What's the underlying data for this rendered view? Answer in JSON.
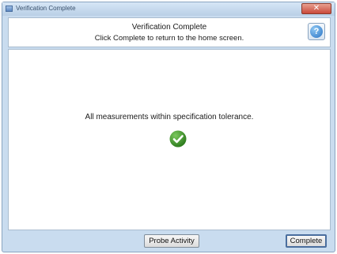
{
  "window": {
    "title": "Verification Complete",
    "close_glyph": "✕"
  },
  "header": {
    "title": "Verification Complete",
    "subtitle": "Click Complete to return to the home screen.",
    "help_icon": "question-mark-icon",
    "help_glyph": "?"
  },
  "main": {
    "message": "All measurements within specification tolerance.",
    "status_icon": "check-circle-icon",
    "status_color": "#3f9a2c"
  },
  "footer": {
    "probe_activity_label": "Probe Activity",
    "complete_label": "Complete"
  }
}
